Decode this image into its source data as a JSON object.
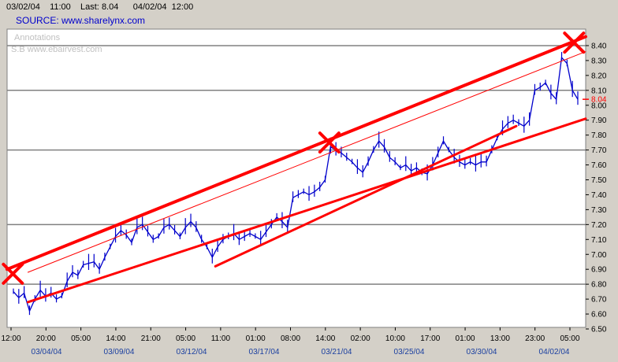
{
  "header": {
    "start_date": "03/02/04",
    "start_time": "11:00",
    "last_label": "Last:",
    "last_value": "8.04",
    "end_date": "04/02/04",
    "end_time": "12:00"
  },
  "source_text": "SOURCE: www.sharelynx.com",
  "watermark": {
    "line1": "Annotations",
    "line2": "S.B www.ebairvest.com"
  },
  "colors": {
    "price": "#0000cc",
    "channel": "#ff0000",
    "grid": "#808080",
    "plot_bg": "#ffffff",
    "date_labels": "#1a3fa0"
  },
  "chart_data": {
    "type": "line",
    "y_range": [
      6.5,
      8.5
    ],
    "y_ticks": [
      "6.50",
      "6.60",
      "6.70",
      "6.80",
      "6.90",
      "7.00",
      "7.10",
      "7.20",
      "7.30",
      "7.40",
      "7.50",
      "7.60",
      "7.70",
      "7.80",
      "7.90",
      "8.00",
      "8.10",
      "8.20",
      "8.30",
      "8.40"
    ],
    "last_value": "8.04",
    "x_time_labels": [
      "12:00",
      "20:00",
      "05:00",
      "14:00",
      "21:00",
      "05:00",
      "11:00",
      "01:00",
      "08:00",
      "14:00",
      "02:00",
      "10:00",
      "17:00",
      "01:00",
      "13:00",
      "23:00",
      "05:00"
    ],
    "x_date_labels": [
      "03/04/04",
      "03/09/04",
      "03/12/04",
      "03/17/04",
      "03/21/04",
      "03/25/04",
      "03/30/04",
      "04/02/04"
    ],
    "horizontal_levels": [
      6.8,
      7.2,
      7.7,
      8.1,
      8.4
    ],
    "series": [
      {
        "values": [
          6.75,
          6.71,
          6.74,
          6.62,
          6.7,
          6.76,
          6.72,
          6.74,
          6.7,
          6.72,
          6.82,
          6.88,
          6.86,
          6.93,
          6.94,
          6.95,
          6.9,
          6.98,
          7.05,
          7.12,
          7.16,
          7.13,
          7.08,
          7.18,
          7.2,
          7.15,
          7.1,
          7.12,
          7.18,
          7.2,
          7.16,
          7.12,
          7.18,
          7.22,
          7.18,
          7.1,
          7.05,
          6.98,
          7.05,
          7.1,
          7.12,
          7.14,
          7.1,
          7.12,
          7.14,
          7.12,
          7.1,
          7.15,
          7.2,
          7.25,
          7.22,
          7.18,
          7.38,
          7.4,
          7.42,
          7.4,
          7.42,
          7.45,
          7.5,
          7.72,
          7.7,
          7.68,
          7.65,
          7.62,
          7.58,
          7.55,
          7.62,
          7.7,
          7.76,
          7.72,
          7.65,
          7.62,
          7.58,
          7.6,
          7.56,
          7.58,
          7.55,
          7.54,
          7.6,
          7.68,
          7.76,
          7.7,
          7.65,
          7.62,
          7.6,
          7.62,
          7.6,
          7.62,
          7.62,
          7.7,
          7.78,
          7.84,
          7.88,
          7.9,
          7.88,
          7.86,
          7.9,
          8.1,
          8.12,
          8.15,
          8.08,
          8.04,
          8.32,
          8.28,
          8.1,
          8.04
        ]
      }
    ],
    "trend_lines": [
      {
        "name": "upper-channel",
        "style": "thick",
        "from": [
          0.0,
          6.9
        ],
        "to": [
          1.0,
          8.46
        ]
      },
      {
        "name": "middle-channel",
        "style": "thin",
        "from": [
          0.036,
          6.88
        ],
        "to": [
          1.0,
          8.36
        ]
      },
      {
        "name": "lower-channel",
        "style": "medium",
        "from": [
          0.036,
          6.68
        ],
        "to": [
          1.0,
          7.91
        ]
      },
      {
        "name": "lower-support",
        "style": "medium",
        "from": [
          0.36,
          6.92
        ],
        "to": [
          0.88,
          7.86
        ]
      }
    ],
    "annotations": [
      {
        "name": "marker-1",
        "type": "x-mark",
        "at": [
          0.01,
          6.87
        ]
      },
      {
        "name": "marker-2",
        "type": "x-mark",
        "at": [
          0.557,
          7.75
        ]
      },
      {
        "name": "marker-3",
        "type": "x-mark",
        "at": [
          0.98,
          8.42
        ]
      }
    ]
  }
}
